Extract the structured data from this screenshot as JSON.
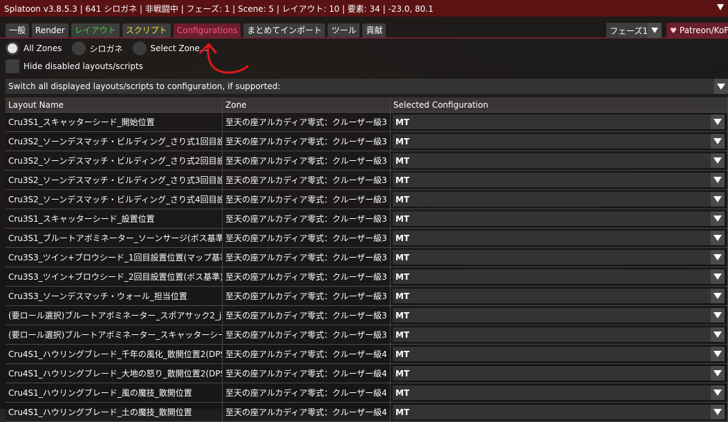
{
  "window": {
    "title": "Splatoon v3.8.5.3 | 641 シロガネ | 非戦闘中 | フェーズ: 1 | Scene: 5 | レイアウト: 10 | 要素: 34 | -23.0, 80.1"
  },
  "tabs": [
    {
      "label": "一般",
      "color": "#ffffff",
      "active": false
    },
    {
      "label": "Render",
      "color": "#ffffff",
      "active": false
    },
    {
      "label": "レイアウト",
      "color": "#3ecf3e",
      "active": false
    },
    {
      "label": "スクリプト",
      "color": "#f0e040",
      "active": false
    },
    {
      "label": "Configurations",
      "color": "#ff4d8a",
      "active": true
    },
    {
      "label": "まとめてインポート",
      "color": "#ffffff",
      "active": false
    },
    {
      "label": "ツール",
      "color": "#ffffff",
      "active": false
    },
    {
      "label": "貢献",
      "color": "#ffffff",
      "active": false
    }
  ],
  "phase_select": {
    "value": "フェーズ1"
  },
  "patreon": {
    "label": "Patreon/KoF"
  },
  "zone_filter": {
    "options": [
      {
        "label": "All Zones",
        "selected": true
      },
      {
        "label": "シロガネ",
        "selected": false
      },
      {
        "label": "Select Zone...",
        "selected": false
      }
    ]
  },
  "hide_disabled": {
    "label": "Hide disabled layouts/scripts",
    "checked": false
  },
  "switch_all": {
    "label": "Switch all displayed layouts/scripts to configuration, if supported:"
  },
  "table": {
    "headers": [
      "Layout Name",
      "Zone",
      "Selected Configuration"
    ],
    "rows": [
      {
        "name": "Cru3S1_スキャッターシード_開始位置",
        "zone": "至天の座アルカディア零式：クルーザー級3",
        "config": "MT"
      },
      {
        "name": "Cru3S2_ソーンデスマッチ・ビルディング_さり式1回目設",
        "zone": "至天の座アルカディア零式：クルーザー級3",
        "config": "MT"
      },
      {
        "name": "Cru3S2_ソーンデスマッチ・ビルディング_さり式2回目設",
        "zone": "至天の座アルカディア零式：クルーザー級3",
        "config": "MT"
      },
      {
        "name": "Cru3S2_ソーンデスマッチ・ビルディング_さり式3回目設",
        "zone": "至天の座アルカディア零式：クルーザー級3",
        "config": "MT"
      },
      {
        "name": "Cru3S2_ソーンデスマッチ・ビルディング_さり式4回目設",
        "zone": "至天の座アルカディア零式：クルーザー級3",
        "config": "MT"
      },
      {
        "name": "Cru3S1_スキャッターシード_設置位置",
        "zone": "至天の座アルカディア零式：クルーザー級3",
        "config": "MT"
      },
      {
        "name": "Cru3S1_ブルートアボミネーター_ソーンサージ(ボス基準",
        "zone": "至天の座アルカディア零式：クルーザー級3",
        "config": "MT"
      },
      {
        "name": "Cru3S3_ツイン+ブロウシード_1回目設置位置(マップ基準",
        "zone": "至天の座アルカディア零式：クルーザー級3",
        "config": "MT"
      },
      {
        "name": "Cru3S3_ツイン+ブロウシード_2回目設置位置(ボス基準)",
        "zone": "至天の座アルカディア零式：クルーザー級3",
        "config": "MT"
      },
      {
        "name": "Cru3S3_ソーンデスマッチ・ウォール_担当位置",
        "zone": "至天の座アルカディア零式：クルーザー級3",
        "config": "MT"
      },
      {
        "name": "(要ロール選択)ブルートアボミネーター_スポアサック2_j",
        "zone": "至天の座アルカディア零式：クルーザー級3",
        "config": "MT"
      },
      {
        "name": "(要ロール選択)ブルートアボミネーター_スキャッターシー",
        "zone": "至天の座アルカディア零式：クルーザー級3",
        "config": "MT"
      },
      {
        "name": "Cru4S1_ハウリングブレード_千年の風化_散開位置2(DPS",
        "zone": "至天の座アルカディア零式：クルーザー級4",
        "config": "MT"
      },
      {
        "name": "Cru4S1_ハウリングブレード_大地の怒り_散開位置2(DPS",
        "zone": "至天の座アルカディア零式：クルーザー級4",
        "config": "MT"
      },
      {
        "name": "Cru4S1_ハウリングブレード_風の魔技_散開位置",
        "zone": "至天の座アルカディア零式：クルーザー級4",
        "config": "MT"
      },
      {
        "name": "Cru4S1_ハウリングブレード_土の魔技_散開位置",
        "zone": "至天の座アルカディア零式：クルーザー級4",
        "config": "MT"
      }
    ]
  },
  "icons": {
    "collapse": "collapse-triangle-icon",
    "dropdown": "chevron-down-icon",
    "heart": "heart-icon",
    "annotation": "red-hand-drawn-arrow"
  }
}
